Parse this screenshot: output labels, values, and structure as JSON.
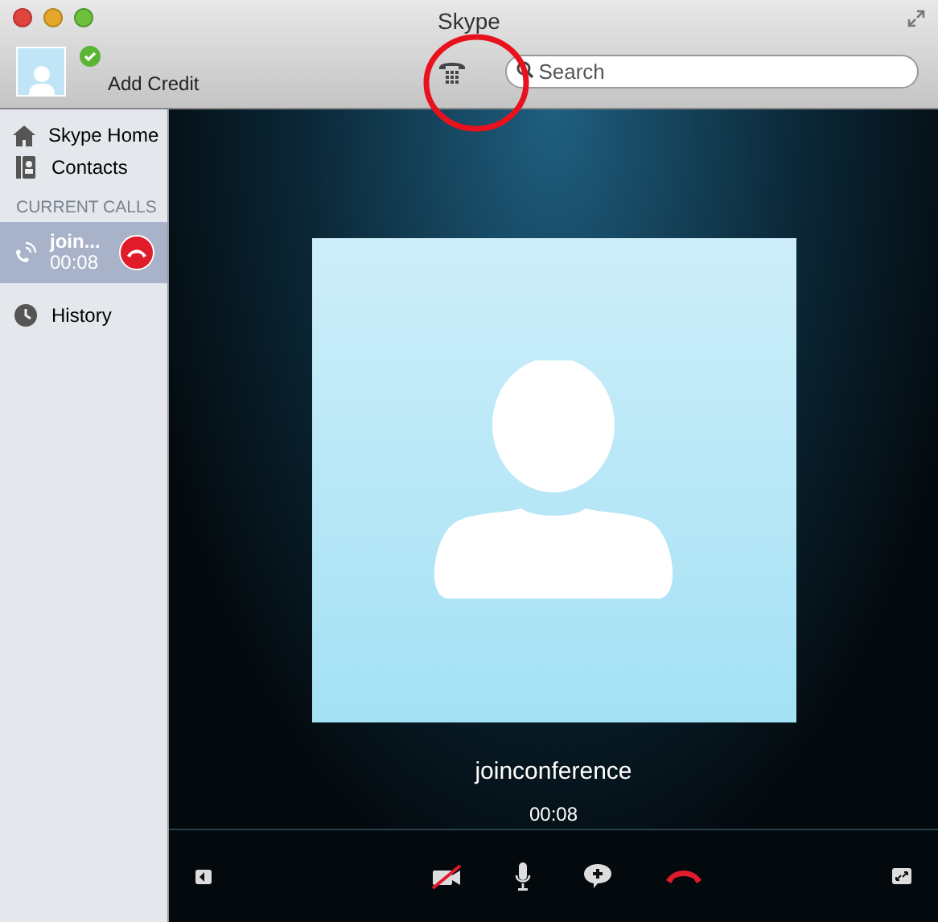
{
  "window": {
    "title": "Skype"
  },
  "toolbar": {
    "credit": "Add Credit",
    "search": {
      "placeholder": "Search"
    }
  },
  "sidebar": {
    "items": [
      {
        "kind": "home",
        "label": "Skype Home",
        "selected": false
      },
      {
        "kind": "contacts",
        "label": "Contacts",
        "selected": false
      }
    ],
    "section": "CURRENT CALLS",
    "calls": [
      {
        "name": "join...",
        "time": "00:08",
        "selected": true
      }
    ],
    "footer": [
      {
        "kind": "history",
        "label": "History",
        "selected": false
      }
    ]
  },
  "call": {
    "name": "joinconference",
    "time": "00:08",
    "video_off": true
  }
}
